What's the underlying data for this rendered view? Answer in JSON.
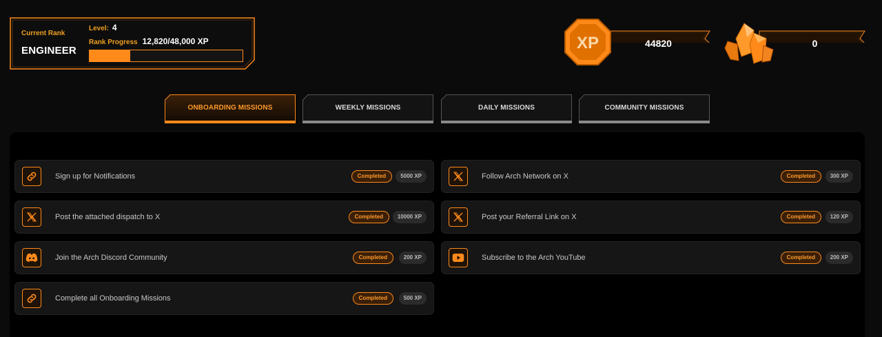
{
  "rank": {
    "current_label": "Current Rank",
    "name": "ENGINEER",
    "level_label": "Level:",
    "level_value": "4",
    "progress_label": "Rank Progress",
    "progress_value": "12,820/48,000 XP",
    "progress_fraction": 0.267
  },
  "currency": {
    "xp_icon_text": "XP",
    "xp_value": "44820",
    "gems_value": "0"
  },
  "tabs": [
    {
      "label": "ONBOARDING MISSIONS",
      "active": true
    },
    {
      "label": "WEEKLY MISSIONS",
      "active": false
    },
    {
      "label": "DAILY MISSIONS",
      "active": false
    },
    {
      "label": "COMMUNITY MISSIONS",
      "active": false
    }
  ],
  "missions": [
    {
      "title": "Sign up for Notifications",
      "status": "Completed",
      "xp": "5000 XP",
      "icon": "link-icon"
    },
    {
      "title": "Follow Arch Network on X",
      "status": "Completed",
      "xp": "300 XP",
      "icon": "x-logo-icon"
    },
    {
      "title": "Post the attached dispatch to X",
      "status": "Completed",
      "xp": "10000 XP",
      "icon": "x-logo-icon"
    },
    {
      "title": "Post your Referral Link on X",
      "status": "Completed",
      "xp": "120 XP",
      "icon": "x-logo-icon"
    },
    {
      "title": "Join the Arch Discord Community",
      "status": "Completed",
      "xp": "200 XP",
      "icon": "discord-icon"
    },
    {
      "title": "Subscribe to the Arch YouTube",
      "status": "Completed",
      "xp": "200 XP",
      "icon": "youtube-icon"
    },
    {
      "title": "Complete all Onboarding Missions",
      "status": "Completed",
      "xp": "500 XP",
      "icon": "link-icon"
    }
  ],
  "colors": {
    "accent": "#ff8a1a",
    "background": "#0b0b0b",
    "card": "#161616"
  }
}
